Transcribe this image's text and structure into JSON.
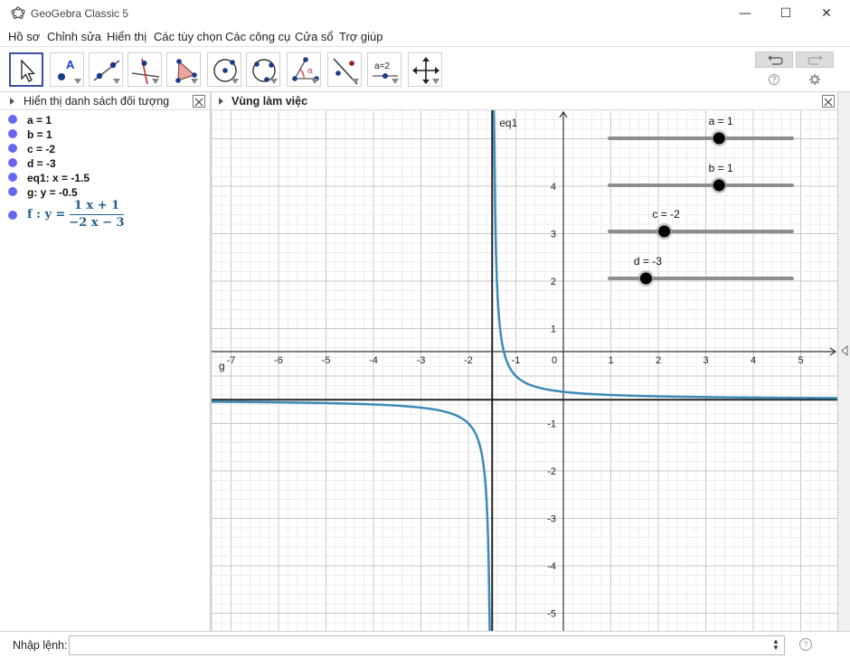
{
  "window": {
    "title": "GeoGebra Classic 5",
    "minimize": "—",
    "maximize": "☐",
    "close": "✕"
  },
  "menu": [
    "Hồ sơ",
    "Chỉnh sửa",
    "Hiển thị",
    "Các tùy chọn",
    "Các công cụ",
    "Cửa sổ",
    "Trợ giúp"
  ],
  "toolbar": {
    "tools": [
      "move-tool",
      "point-tool",
      "line-tool",
      "perpendicular-tool",
      "polygon-tool",
      "circle-tool",
      "circle-three-points-tool",
      "angle-tool",
      "reflect-tool",
      "slider-tool",
      "move-graphics-tool"
    ],
    "slider_tool_label": "a=2",
    "angle_symbol": "α",
    "point_label": "A"
  },
  "algebra": {
    "title": "Hiển thị danh sách đối tượng",
    "items": [
      "a = 1",
      "b = 1",
      "c = -2",
      "d = -3",
      "eq1: x = -1.5",
      "g: y = -0.5"
    ],
    "function": {
      "prefix": "f : y =",
      "numerator": "1 x + 1",
      "denominator": "−2 x − 3"
    },
    "dot_color": "#6767f2"
  },
  "graphics": {
    "title": "Vùng làm việc",
    "x_ticks": [
      "-7",
      "-6",
      "-5",
      "-4",
      "-3",
      "-2",
      "-1",
      "0",
      "1",
      "2",
      "3",
      "4",
      "5"
    ],
    "y_ticks": [
      "4",
      "3",
      "2",
      "1",
      "-1",
      "-2",
      "-3",
      "-4",
      "-5"
    ],
    "labels": {
      "eq1": "eq1",
      "g": "g"
    },
    "curve_color": "#3e8ab8",
    "sliders": [
      {
        "label": "a = 1",
        "value": 1,
        "min": -5,
        "max": 5
      },
      {
        "label": "b = 1",
        "value": 1,
        "min": -5,
        "max": 5
      },
      {
        "label": "c = -2",
        "value": -2,
        "min": -5,
        "max": 5
      },
      {
        "label": "d = -3",
        "value": -3,
        "min": -5,
        "max": 5
      }
    ]
  },
  "input": {
    "label": "Nhập lệnh:",
    "value": ""
  }
}
